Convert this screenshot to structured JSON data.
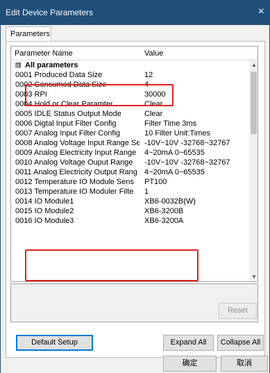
{
  "window": {
    "title": "Edit Device Parameters",
    "close_glyph": "×"
  },
  "tabs": [
    {
      "label": "Parameters"
    }
  ],
  "grid": {
    "columns": [
      "Parameter Name",
      "Value"
    ],
    "group_label": "All parameters",
    "expander_glyph": "⊟",
    "rows": [
      {
        "name": "0001 Produced Data Size",
        "value": "12"
      },
      {
        "name": "0002 Consumed Data Size",
        "value": "4"
      },
      {
        "name": "0003 RPI",
        "value": "30000"
      },
      {
        "name": "0004 Hold or Clear Paramter",
        "value": "Clear"
      },
      {
        "name": "0005 IDLE Status Output Mode",
        "value": "Clear"
      },
      {
        "name": "0006 Digtal Input Filter Config",
        "value": "Filter Time 3ms"
      },
      {
        "name": "0007 Analog Input Filter Config",
        "value": "10 Filter Unit:Times"
      },
      {
        "name": "0008 Analog Voltage Input Range Se",
        "value": "-10V~10V -32768~32767"
      },
      {
        "name": "0009 Analog Electricity Input Range",
        "value": "4~20mA 0~65535"
      },
      {
        "name": "0010 Analog Voltage Ouput Range",
        "value": "-10V~10V -32768~32767"
      },
      {
        "name": "0011 Analog Electricity Output Rang",
        "value": "4~20mA 0~65535"
      },
      {
        "name": "0012 Temperature IO Module Sens",
        "value": "PT100"
      },
      {
        "name": "0013 Temperature IO Moduler Filte",
        "value": "1"
      },
      {
        "name": "0014 IO Module1",
        "value": "XB6-0032B(W)"
      },
      {
        "name": "0015 IO Module2",
        "value": "XB6-3200B"
      },
      {
        "name": "0016 IO Module3",
        "value": "XB6-3200A"
      }
    ],
    "scroll_up_glyph": "▲",
    "scroll_down_glyph": "▼"
  },
  "buttons": {
    "reset": "Reset",
    "default_setup": "Default Setup",
    "expand_all": "Expand All",
    "collapse_all": "Collapse All",
    "ok": "确定",
    "cancel": "取消"
  },
  "colors": {
    "titlebar": "#1f4e79",
    "highlight_border": "#e02020"
  }
}
